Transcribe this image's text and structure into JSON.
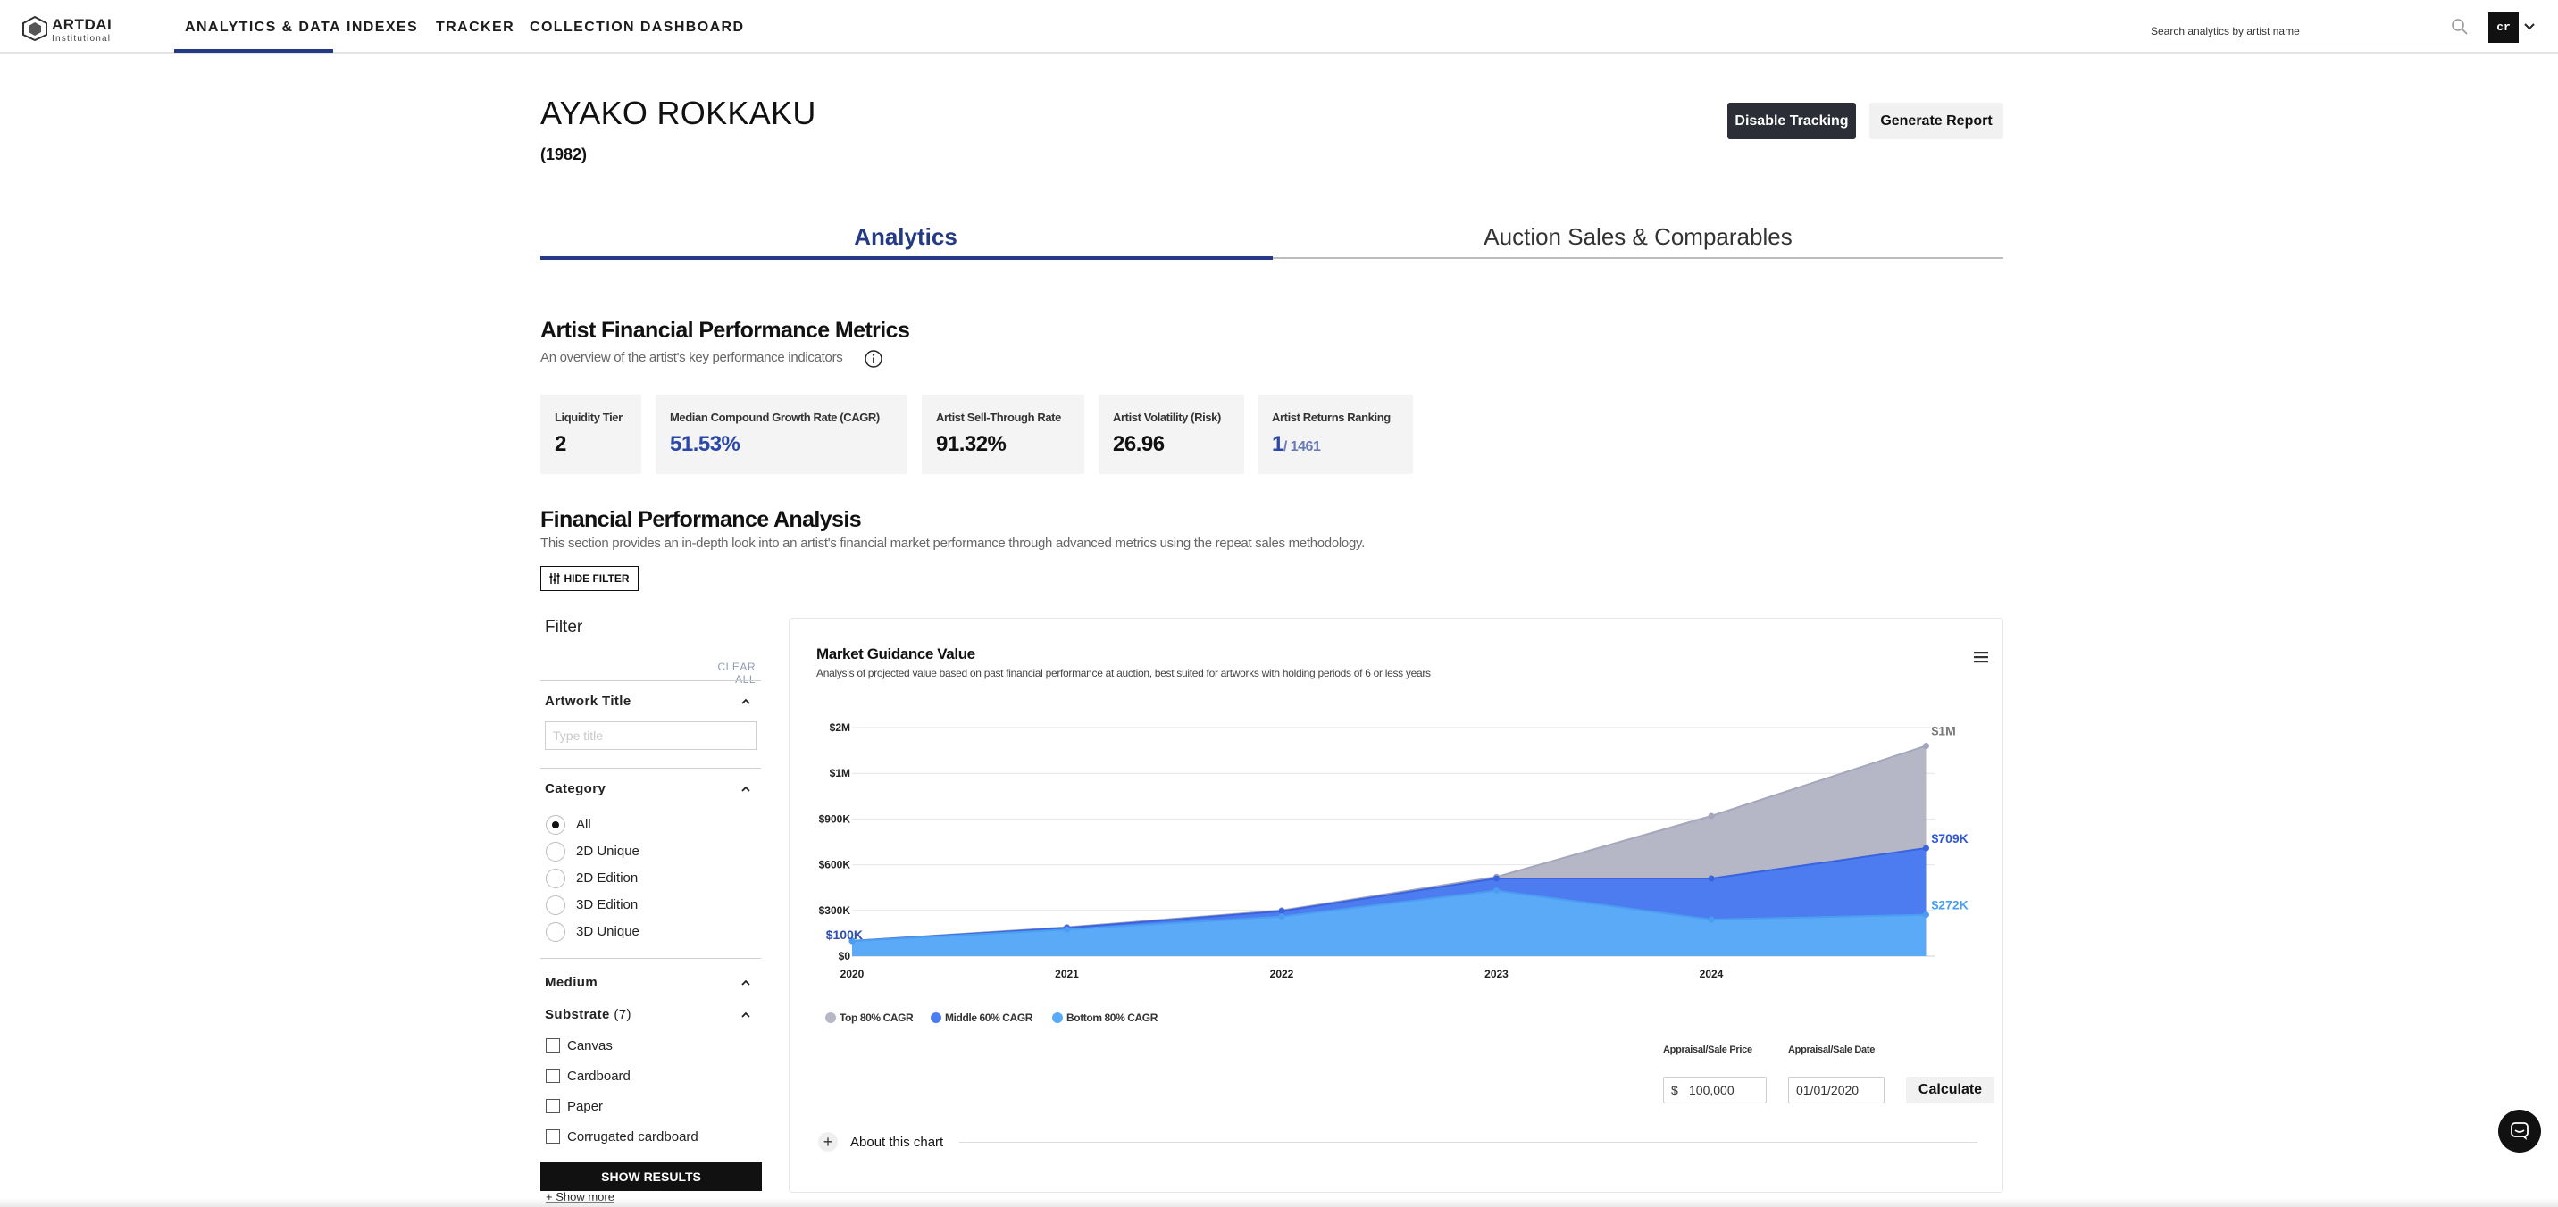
{
  "brand": {
    "name": "ARTDAI",
    "sub": "Institutional"
  },
  "nav": {
    "items": [
      "ANALYTICS & DATA",
      "INDEXES",
      "TRACKER",
      "COLLECTION DASHBOARD"
    ],
    "active": "ANALYTICS & DATA",
    "search_placeholder": "Search analytics by artist name",
    "user_initials": "cr"
  },
  "artist": {
    "name": "AYAKO ROKKAKU",
    "year": "(1982)",
    "disable_tracking": "Disable Tracking",
    "generate_report": "Generate Report"
  },
  "tabs": [
    {
      "label": "Analytics",
      "active": true
    },
    {
      "label": "Auction Sales & Comparables",
      "active": false
    }
  ],
  "metrics_section": {
    "title": "Artist Financial Performance Metrics",
    "subtitle": "An overview of the artist's key performance indicators",
    "cards": [
      {
        "label": "Liquidity Tier",
        "value": "2"
      },
      {
        "label": "Median Compound Growth Rate (CAGR)",
        "value": "51.53%"
      },
      {
        "label": "Artist Sell-Through Rate",
        "value": "91.32%"
      },
      {
        "label": "Artist Volatility (Risk)",
        "value": "26.96"
      },
      {
        "label": "Artist Returns Ranking",
        "value": "1",
        "total": "/ 1461"
      }
    ]
  },
  "analysis_section": {
    "title": "Financial Performance Analysis",
    "subtitle": "This section provides an in-depth look into an artist's financial market performance through advanced metrics using the repeat sales methodology.",
    "hide_filter": "HIDE FILTER"
  },
  "filter": {
    "title": "Filter",
    "clear_all": "CLEAR ALL",
    "artwork_title": {
      "label": "Artwork Title",
      "placeholder": "Type title"
    },
    "category": {
      "label": "Category",
      "options": [
        "All",
        "2D Unique",
        "2D Edition",
        "3D Edition",
        "3D Unique"
      ],
      "selected": "All"
    },
    "medium": {
      "label": "Medium"
    },
    "substrate": {
      "label": "Substrate",
      "count": "(7)",
      "options": [
        "Canvas",
        "Cardboard",
        "Paper",
        "Corrugated cardboard"
      ]
    },
    "show_results": "SHOW RESULTS",
    "show_more": "+ Show more"
  },
  "chart_card": {
    "title": "Market Guidance Value",
    "subtitle": "Analysis of projected value based on past financial performance at auction, best suited for artworks with holding periods of 6 or less years",
    "calc": {
      "price_label": "Appraisal/Sale Price",
      "price_currency": "$",
      "price_value": "100,000",
      "date_label": "Appraisal/Sale Date",
      "date_value": "01/01/2020",
      "button": "Calculate"
    },
    "about": "About this chart"
  },
  "chart_data": {
    "type": "area",
    "title": "Market Guidance Value",
    "x": [
      2020,
      2021,
      2022,
      2023,
      2024,
      2025
    ],
    "x_tick_labels": [
      "2020",
      "2021",
      "2022",
      "2023",
      "2024"
    ],
    "y_tick_values": [
      0,
      300000,
      600000,
      900000,
      1200000,
      1500000
    ],
    "y_tick_labels": [
      "$0",
      "$300K",
      "$600K",
      "$900K",
      "$1M",
      "$2M"
    ],
    "ylim": [
      0,
      1500000
    ],
    "grid": true,
    "legend_position": "bottom-left",
    "start_label": "$100K",
    "series": [
      {
        "name": "Top 80% CAGR",
        "color": "#b5b7c7",
        "line_color": "#a4a7bb",
        "values": [
          100000,
          190000,
          300000,
          520000,
          920000,
          1380000
        ],
        "end_label": "$1M",
        "end_label_color": "#777777"
      },
      {
        "name": "Middle 60% CAGR",
        "color": "#4c7cf0",
        "line_color": "#3a63e0",
        "values": [
          100000,
          185000,
          295000,
          510000,
          510000,
          709000
        ],
        "end_label": "$709K",
        "end_label_color": "#2f57d6"
      },
      {
        "name": "Bottom 80% CAGR",
        "color": "#5aaaf7",
        "line_color": "#4b9df2",
        "values": [
          100000,
          175000,
          260000,
          430000,
          240000,
          272000
        ],
        "end_label": "$272K",
        "end_label_color": "#4a9ff0"
      }
    ]
  },
  "colors": {
    "accent": "#243a85",
    "dark_button": "#2b2e36",
    "card_bg": "#f4f4f4"
  },
  "icons": [
    "search-icon",
    "chevron-down-icon",
    "info-icon",
    "sliders-icon",
    "chevron-up-icon",
    "menu-icon",
    "plus-icon",
    "chat-icon"
  ]
}
